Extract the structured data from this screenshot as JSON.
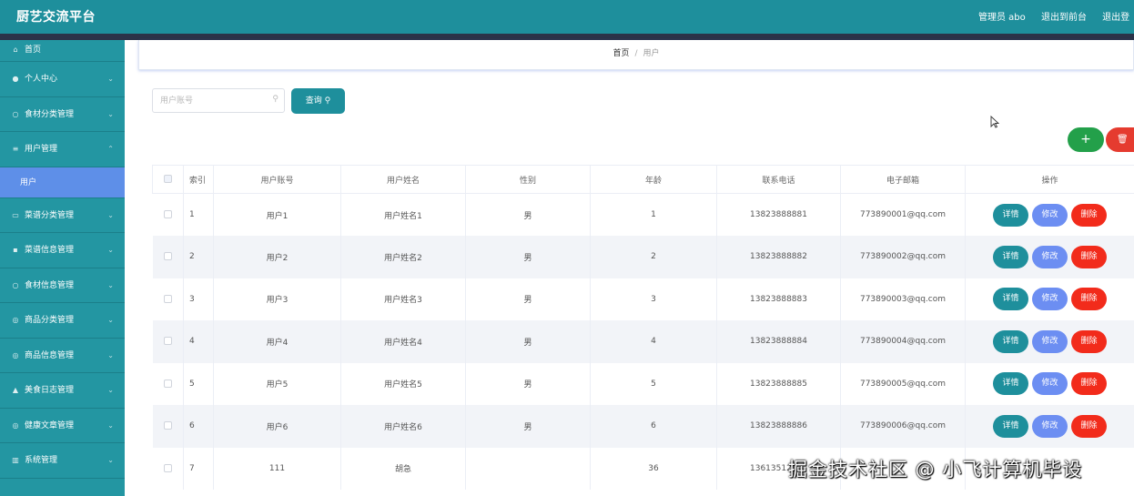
{
  "header": {
    "title": "厨艺交流平台",
    "admin_label": "管理员 abo",
    "back_front": "退出到前台",
    "logout": "退出登"
  },
  "sidebar": {
    "items": [
      {
        "label": "首页",
        "icon": "home-icon"
      },
      {
        "label": "个人中心",
        "icon": "user-icon"
      },
      {
        "label": "食材分类管理",
        "icon": "circle-icon"
      },
      {
        "label": "用户管理",
        "icon": "list-icon"
      },
      {
        "label": "菜谱分类管理",
        "icon": "doc-icon"
      },
      {
        "label": "菜谱信息管理",
        "icon": "chat-icon"
      },
      {
        "label": "食材信息管理",
        "icon": "circle-icon"
      },
      {
        "label": "商品分类管理",
        "icon": "circle-icon"
      },
      {
        "label": "商品信息管理",
        "icon": "circle-icon"
      },
      {
        "label": "美食日志管理",
        "icon": "cart-icon"
      },
      {
        "label": "健康文章管理",
        "icon": "circle-icon"
      },
      {
        "label": "系统管理",
        "icon": "chart-icon"
      }
    ],
    "active_sub": "用户"
  },
  "breadcrumb": {
    "home": "首页",
    "separator": "/",
    "current": "用户"
  },
  "search": {
    "placeholder": "用户账号",
    "button": "查询"
  },
  "actions": {
    "add": "+",
    "delete": "🗑"
  },
  "table": {
    "headers": [
      "索引",
      "用户账号",
      "用户姓名",
      "性别",
      "年龄",
      "联系电话",
      "电子邮箱",
      "操作"
    ],
    "rows": [
      {
        "index": "1",
        "account": "用户1",
        "name": "用户姓名1",
        "gender": "男",
        "age": "1",
        "phone": "13823888881",
        "email": "773890001@qq.com"
      },
      {
        "index": "2",
        "account": "用户2",
        "name": "用户姓名2",
        "gender": "男",
        "age": "2",
        "phone": "13823888882",
        "email": "773890002@qq.com"
      },
      {
        "index": "3",
        "account": "用户3",
        "name": "用户姓名3",
        "gender": "男",
        "age": "3",
        "phone": "13823888883",
        "email": "773890003@qq.com"
      },
      {
        "index": "4",
        "account": "用户4",
        "name": "用户姓名4",
        "gender": "男",
        "age": "4",
        "phone": "13823888884",
        "email": "773890004@qq.com"
      },
      {
        "index": "5",
        "account": "用户5",
        "name": "用户姓名5",
        "gender": "男",
        "age": "5",
        "phone": "13823888885",
        "email": "773890005@qq.com"
      },
      {
        "index": "6",
        "account": "用户6",
        "name": "用户姓名6",
        "gender": "男",
        "age": "6",
        "phone": "13823888886",
        "email": "773890006@qq.com"
      },
      {
        "index": "7",
        "account": "111",
        "name": "胡急",
        "gender": "",
        "age": "36",
        "phone": "13613512",
        "email": ""
      }
    ],
    "op_detail": "详情",
    "op_edit": "修改",
    "op_delete": "删除"
  },
  "watermark": "掘金技术社区 @ 小飞计算机毕设",
  "colors": {
    "primary": "#1e8f9c",
    "sidebar": "#2396a2",
    "active": "#5e8fe8",
    "edit": "#6c8ef2",
    "danger": "#f22b1b",
    "success": "#23a04a"
  }
}
